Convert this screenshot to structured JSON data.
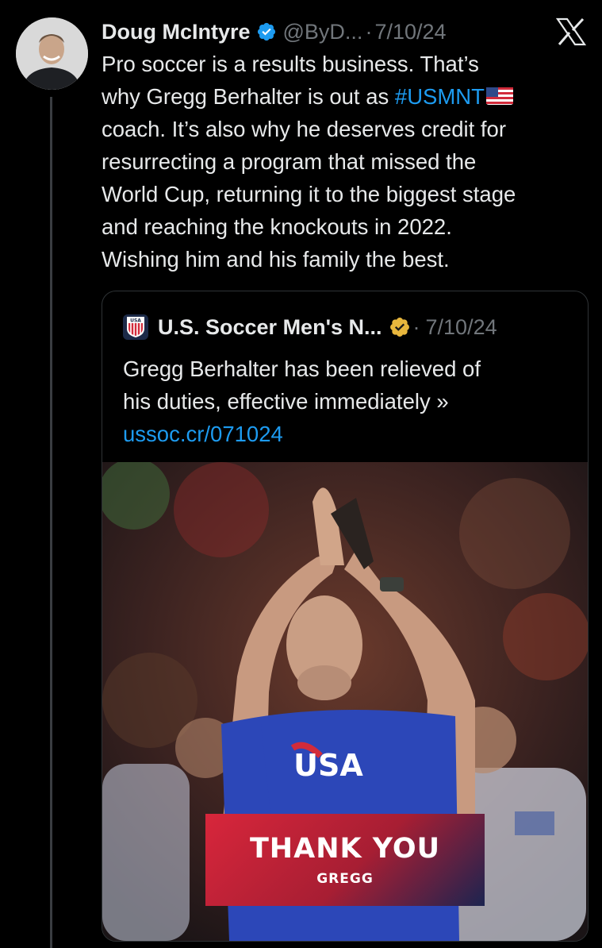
{
  "tweet": {
    "author_name": "Doug McIntyre",
    "handle": "@ByD...",
    "separator": "·",
    "date": "7/10/24",
    "text_lines": [
      "Pro soccer is a results business. That’s",
      "why Gregg Berhalter is out as ",
      "coach. It’s also why he deserves credit for",
      "resurrecting a program that missed the",
      "World Cup, returning it to the biggest stage",
      "and reaching the knockouts in 2022.",
      "Wishing him and his family the best."
    ],
    "hashtag": "#USMNT",
    "avatar_icon": "person-photo-icon",
    "verified_badge_color": "#1d9bf0"
  },
  "quote": {
    "author_name": "U.S. Soccer Men's N...",
    "separator": "·",
    "date": "7/10/24",
    "text_lines": [
      "Gregg Berhalter has been relieved of",
      "his duties, effective immediately »"
    ],
    "link": "ussoc.cr/071024",
    "verified_badge_color": "#e8b73d",
    "avatar_label": "USA",
    "media": {
      "banner_title": "THANK YOU",
      "banner_subtitle": "GREGG",
      "shirt_text": "USA"
    }
  },
  "colors": {
    "background": "#000000",
    "text": "#e7e9ea",
    "muted": "#71767b",
    "link": "#1d9bf0"
  }
}
